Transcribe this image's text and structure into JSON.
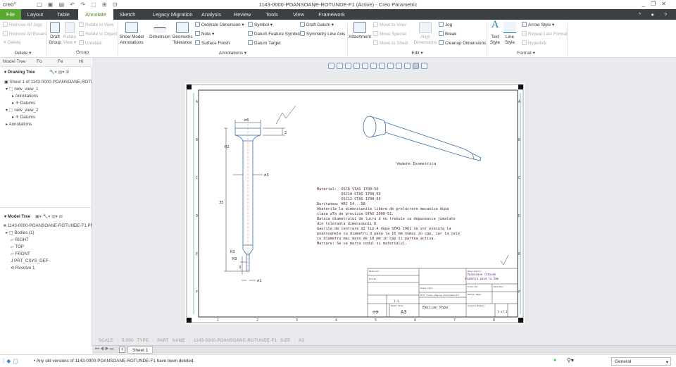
{
  "app": {
    "logo": "creo°",
    "title": "1143-0000-POANSOANE-ROTUNDE-F1 (Active) - Creo Parametric",
    "window_controls": [
      "_",
      "❐",
      "✕"
    ]
  },
  "tabs": [
    "File",
    "Layout",
    "Table",
    "Annotate",
    "Sketch",
    "Legacy Migration",
    "Analysis",
    "Review",
    "Tools",
    "View",
    "Framework"
  ],
  "active_tab": "Annotate",
  "ribbon": {
    "delete": {
      "items": [
        "Remove All Jogs",
        "Remove All Breaks",
        "Delete"
      ],
      "label": "Delete ▾"
    },
    "group": {
      "draft_group": "Draft Group",
      "relate_view": "Relate View ▾",
      "items": [
        "Relate to View",
        "Relate to Object",
        "Unrelate"
      ],
      "label": "Group"
    },
    "annotations": {
      "show_model": "Show Model Annotations",
      "dimension": "Dimension",
      "geometric_tolerance": "Geometric Tolerance",
      "col1": [
        "Ordinate Dimension ▾",
        "Note ▾",
        "Surface Finish"
      ],
      "col2": [
        "Symbol ▾",
        "Datum Feature Symbol",
        "Datum Target"
      ],
      "col3": [
        "Draft Datum ▾",
        "Symmetry Line Axis"
      ],
      "label": "Annotations ▾"
    },
    "edit": {
      "attachment": "Attachment",
      "col1": [
        "Move to View",
        "Move Special",
        "Move to Sheet"
      ],
      "align": "Align Dimensions",
      "col2": [
        "Jog",
        "Break",
        "Cleanup Dimensions"
      ],
      "label": "Edit ▾"
    },
    "format": {
      "text_style": "Text Style",
      "line_style": "Line Style",
      "items": [
        "Arrow Style ▾",
        "Repeat Last Format",
        "Hyperlink"
      ],
      "label": "Format ▾"
    }
  },
  "left_panel": {
    "tabs": [
      "Model Tree",
      "Fo",
      "Fe",
      "Hi"
    ],
    "drawing_tree": {
      "title": "Drawing Tree",
      "items": [
        "Sheet 1 of 1143-0000-POANSOANE-ROTUNDE-F1",
        "new_view_1",
        "Annotations",
        "Datums",
        "new_view_2",
        "Datums",
        "Annotations"
      ]
    },
    "model_tree": {
      "title": "Model Tree",
      "items": [
        "1143-0000-POANSOANE-ROTUNDE-F1.PRT",
        "Bodies (1)",
        "RIGHT",
        "TOP",
        "FRONT",
        "PRT_CSYS_DEF",
        "Revolve 1"
      ]
    }
  },
  "drawing": {
    "dims": {
      "d_head": "⌀6",
      "h_head": "2",
      "r2": "R2",
      "d_body": "⌀3",
      "length": "35",
      "r3a": "R3",
      "r3b": "R3",
      "tip_len": "3",
      "d_tip": "⌀1"
    },
    "iso_label": "Vedere Isometrica",
    "notes": [
      "Material:  OSC8 STAS 1700-50",
      "           OSC10 STAS 1700-50",
      "           OSC12 STAS 1700-50",
      "Duritatea: HRC 54...58",
      "Abaterile la dimensiunile libere de prelucrare mecanica dupa",
      "clasa a7a de precizie STAS 2000-51.",
      "Bataia diametrului de lucru d nu trebuie sa depaseasca jumatate",
      "din toleranta dimensiunii D.",
      "Gaurile de centrare d2 tip A dupa STAS 1961 se vor executa la",
      "poansoanele cu diametru d pana la 16 mm numai in cap, iar la cele",
      "cu diametru mai mare de 18 mm in cap si partea activa.",
      "Marcare: Se va marca codul si materialul."
    ],
    "title_block": {
      "description": "Poansoane rotunde",
      "description2": "diametru pana la 5mm",
      "author": "Emilian Popa",
      "size": "A3",
      "scale": "1:1",
      "sheet": "1 of 1",
      "fields": [
        "Material:",
        "Finish:",
        "Drawn Type:",
        "Edit Scale: Pagina (Confidential)",
        "Description:",
        "Drawn By:",
        "Date/Rev:",
        "Design Name:",
        "Drawing Number:",
        "Sheet Size:"
      ]
    },
    "col_labels": [
      "1",
      "2",
      "3",
      "4",
      "5",
      "6",
      "7",
      "8"
    ],
    "row_labels": [
      "A",
      "B",
      "C",
      "D",
      "E",
      "F"
    ]
  },
  "info_line": "SCALE : 5.000    TYPE : PART    NAME : 1143-0000-POANSOANE-ROTUNDE-F1    SIZE : A3",
  "sheet_tabs": {
    "nav": "⏮ ◀ ▶ ⏭",
    "add": "+",
    "sheet": "Sheet 1"
  },
  "status": {
    "message": "Any old versions of 1143-0000-POANSOANE-ROTUNDE-F1 have been deleted.",
    "filter": "General"
  }
}
